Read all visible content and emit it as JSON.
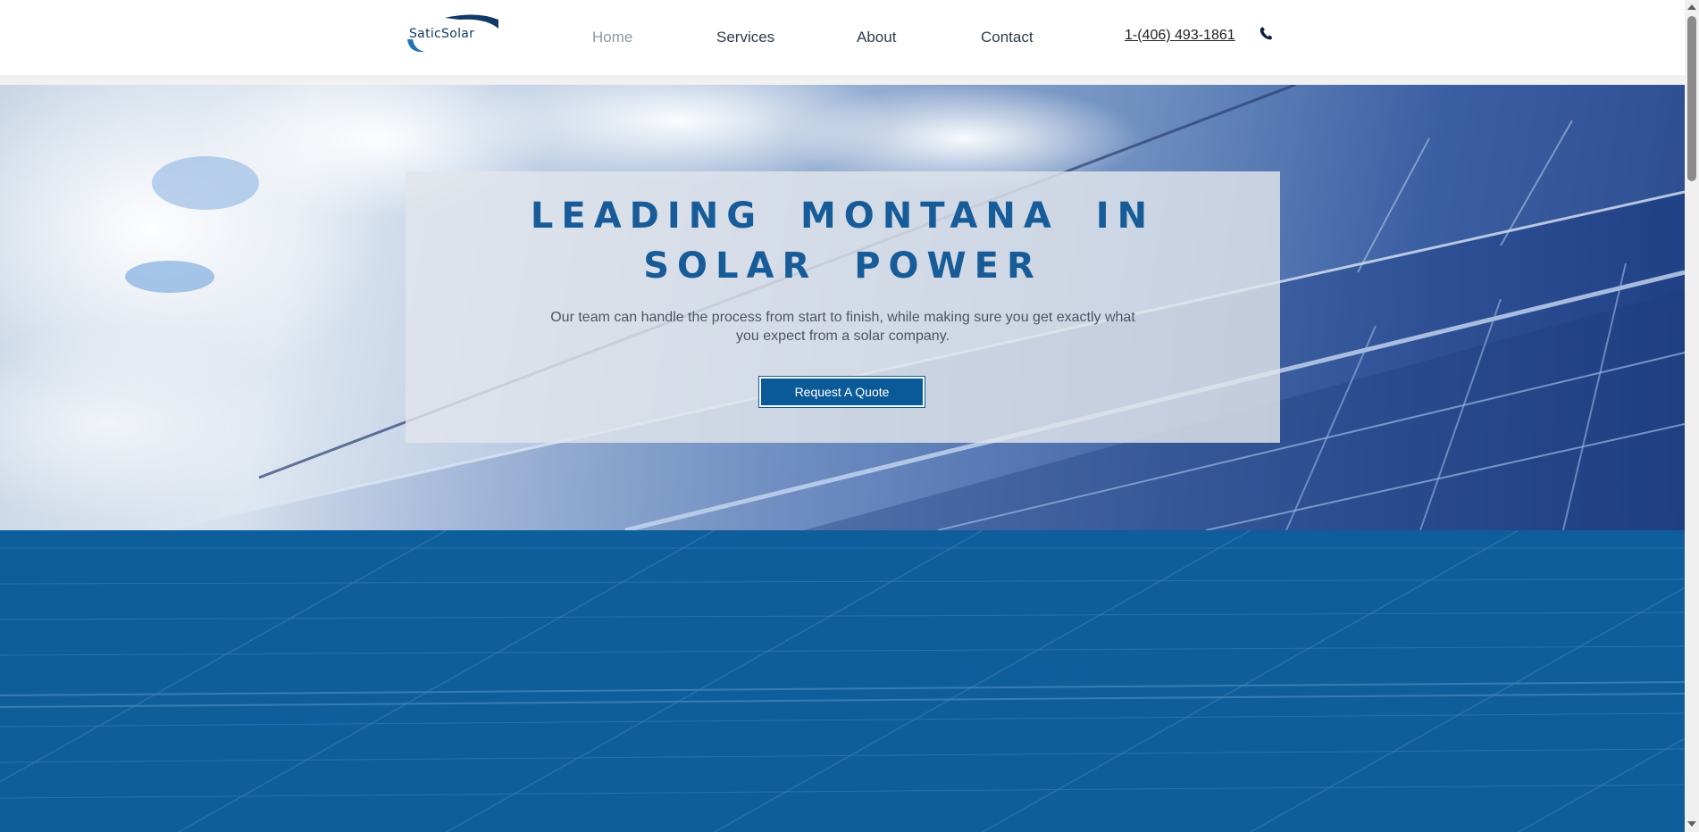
{
  "header": {
    "logo_text": "SaticSolar",
    "nav": [
      {
        "label": "Home",
        "active": true
      },
      {
        "label": "Services",
        "active": false
      },
      {
        "label": "About",
        "active": false
      },
      {
        "label": "Contact",
        "active": false
      }
    ],
    "phone": "1-(406) 493-1861",
    "phone_icon": "phone-icon"
  },
  "hero": {
    "title_line1": "LEADING MONTANA IN",
    "title_line2": "SOLAR POWER",
    "subtitle": "Our team can handle the process from start to finish, while making sure you get exactly what you expect from a solar company.",
    "cta_label": "Request A Quote"
  },
  "colors": {
    "brand_blue": "#175c98",
    "button_blue": "#0b5a98",
    "panel_blue": "#0e5e9b"
  }
}
